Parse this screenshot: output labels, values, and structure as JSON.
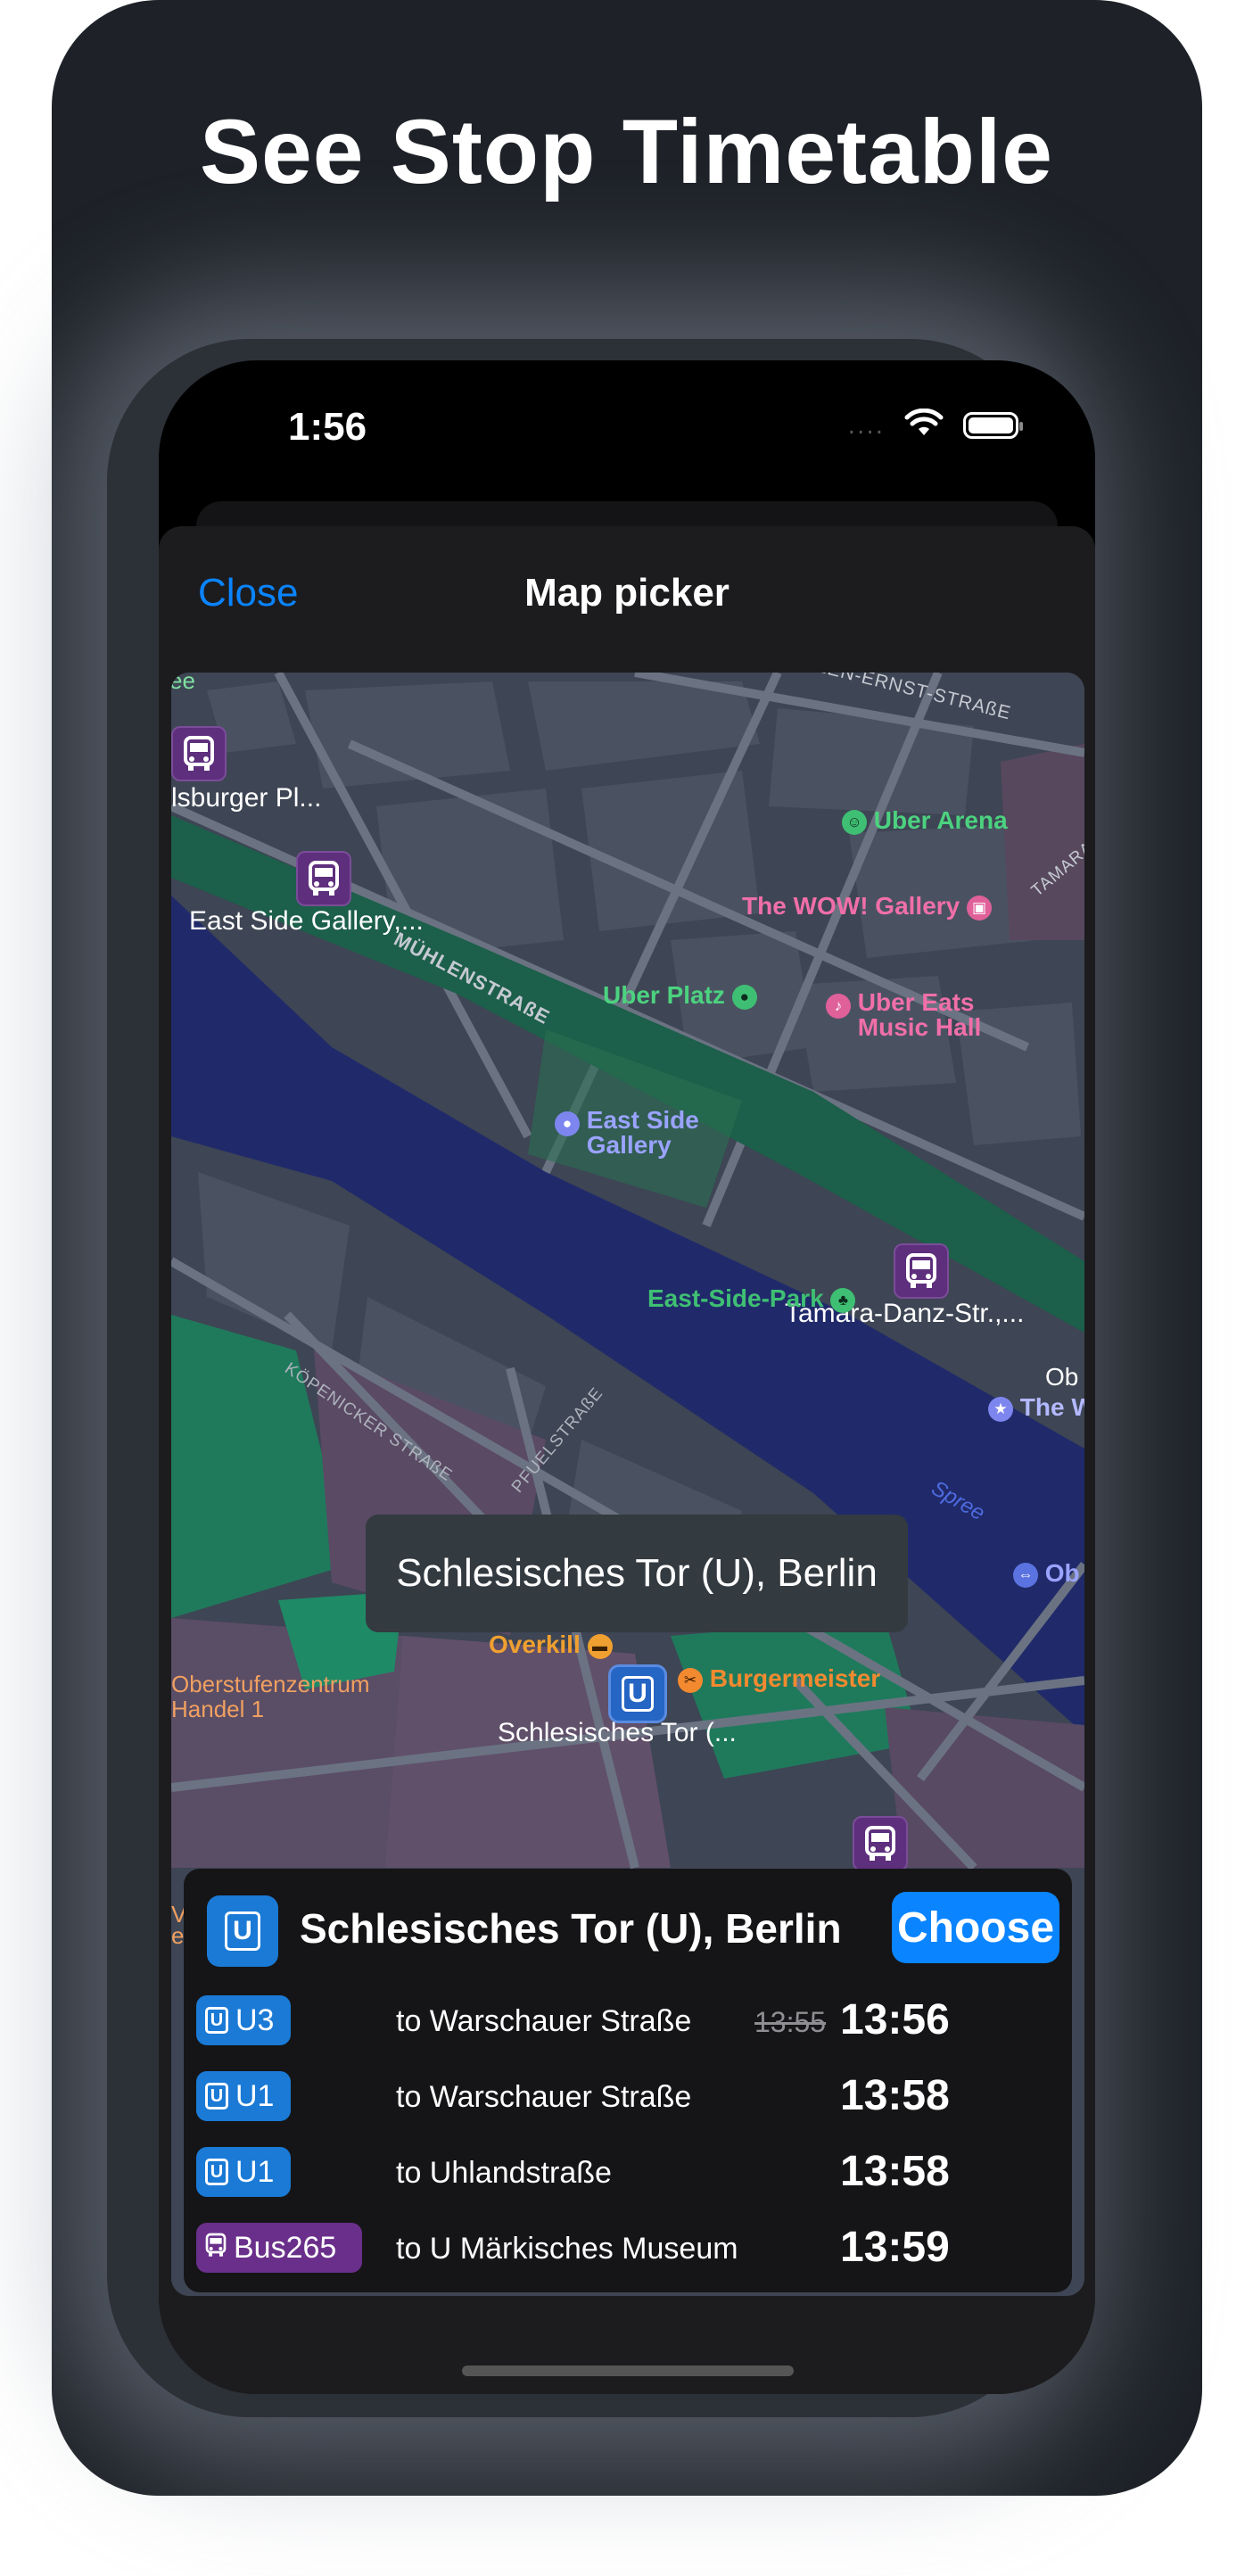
{
  "headline": "See Stop Timetable",
  "status_bar": {
    "time": "1:56",
    "signal_dots": "....",
    "wifi_icon": "wifi-icon",
    "battery_icon": "battery-icon"
  },
  "nav": {
    "close_label": "Close",
    "title": "Map picker"
  },
  "map": {
    "street_labels": [
      "HELEN-ERNST-STRAßE",
      "MÜHLENSTRAßE",
      "KÖPENICKER STRAßE",
      "PFUELSTRAßE",
      "TAMARA"
    ],
    "water_label": "Spree",
    "pois": {
      "uber_arena": "Uber Arena",
      "wow_gallery": "The WOW! Gallery",
      "uber_platz": "Uber Platz",
      "uber_eats_1": "Uber Eats",
      "uber_eats_2": "Music Hall",
      "east_side_gallery_1": "East Side",
      "east_side_gallery_2": "Gallery",
      "east_side_park": "East-Side-Park",
      "ob_1": "Ob",
      "the_w": "The W",
      "ob_2": "Ob",
      "overkill": "Overkill",
      "burgermeister": "Burgermeister",
      "osz_1": "Oberstufenzentrum",
      "osz_2": "Handel 1",
      "edge_v": "V",
      "edge_e": "e"
    },
    "stops": {
      "top_left_partial": "ee",
      "warschauer": "lsburger Pl...",
      "east_side_gallery_stop": "East Side Gallery,...",
      "tamara": "Tamara-Danz-Str.,...",
      "schlesisches": "Schlesisches Tor (..."
    },
    "selected_tooltip": "Schlesisches Tor (U), Berlin"
  },
  "panel": {
    "stop_name": "Schlesisches Tor (U), Berlin",
    "choose_label": "Choose",
    "departures": [
      {
        "line": "U3",
        "type": "ubahn",
        "destination": "to Warschauer Straße",
        "scheduled": "13:55",
        "time": "13:56"
      },
      {
        "line": "U1",
        "type": "ubahn",
        "destination": "to Warschauer Straße",
        "scheduled": "",
        "time": "13:58"
      },
      {
        "line": "U1",
        "type": "ubahn",
        "destination": "to Uhlandstraße",
        "scheduled": "",
        "time": "13:58"
      },
      {
        "line": "Bus265",
        "type": "bus",
        "destination": "to U Märkisches Museum",
        "scheduled": "",
        "time": "13:59"
      }
    ]
  },
  "colors": {
    "accent": "#0a84ff",
    "ubahn": "#1a7ad6",
    "bus": "#6a2f8a",
    "map_water": "#232c6e",
    "map_park": "#1e6e55"
  }
}
